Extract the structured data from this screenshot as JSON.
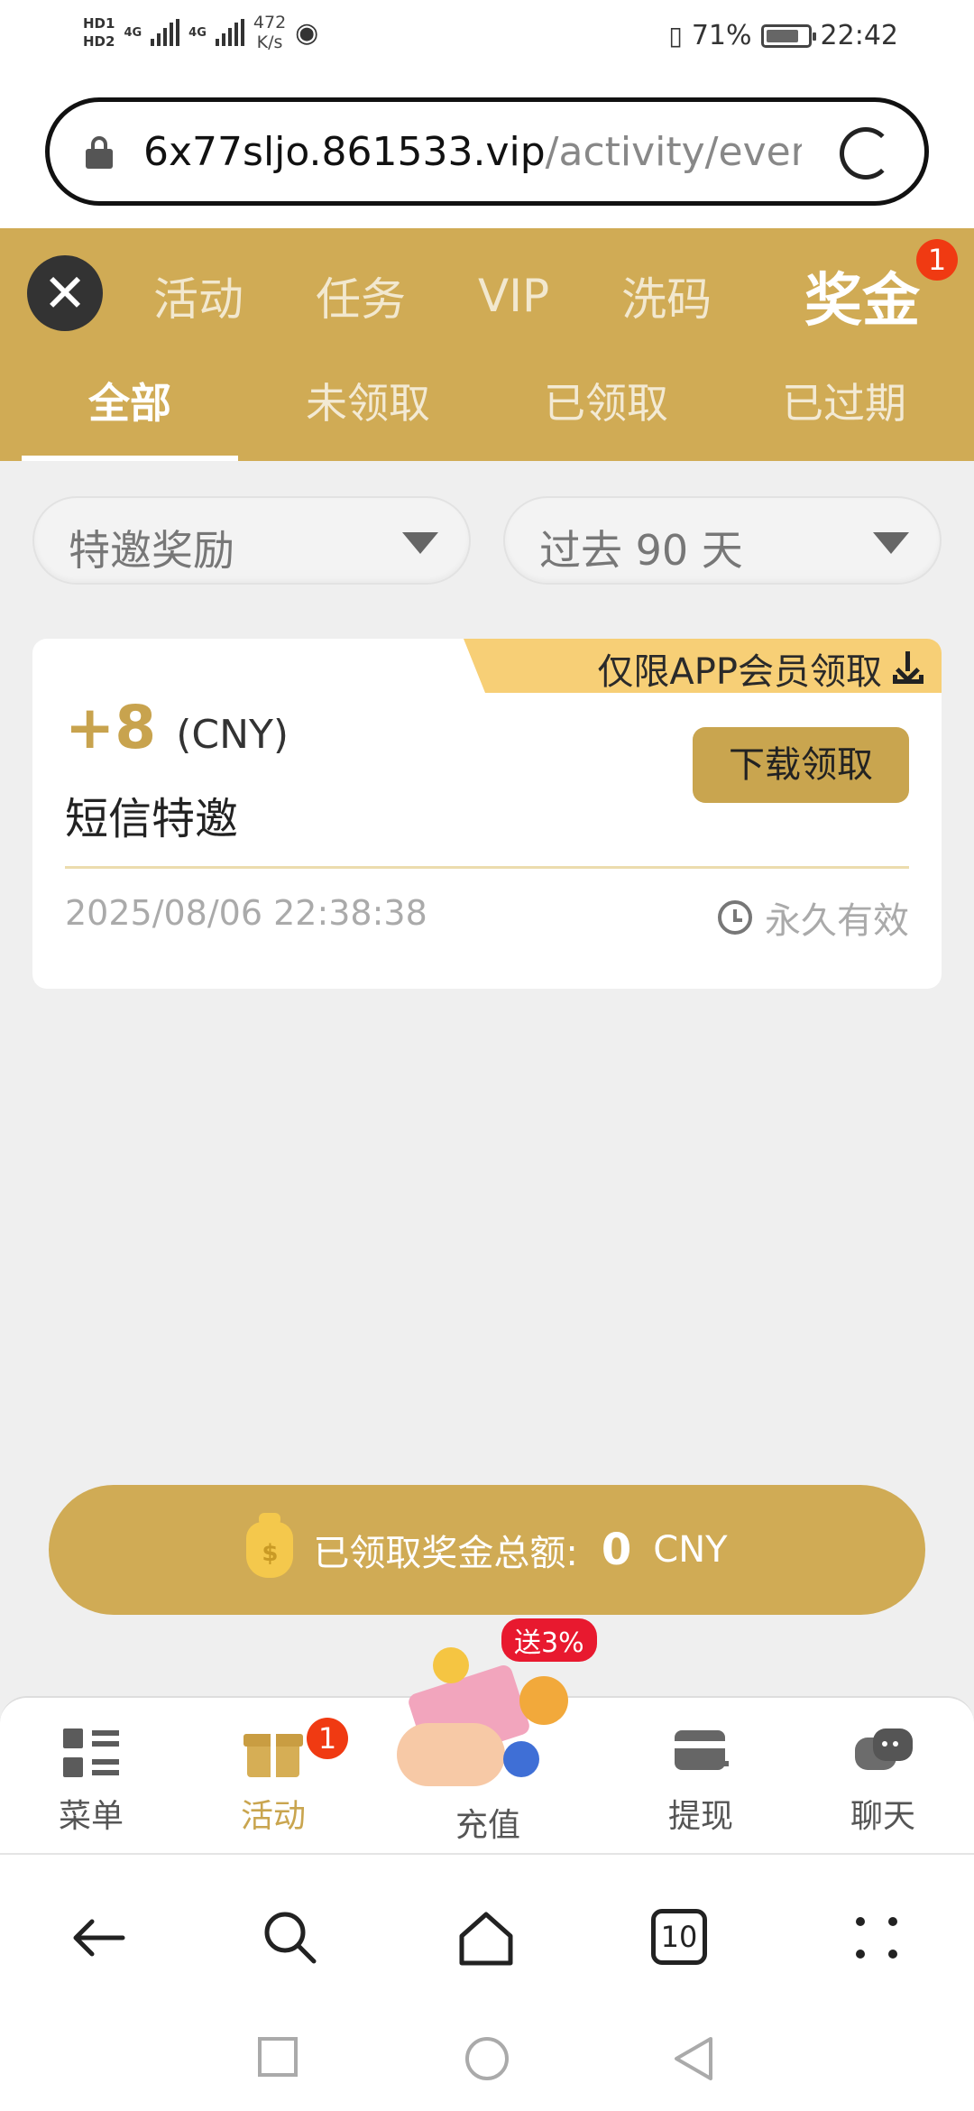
{
  "status_bar": {
    "hd1": "HD1",
    "hd2": "HD2",
    "signal1": "4G",
    "signal2": "4G",
    "speed_value": "472",
    "speed_unit": "K/s",
    "battery_pct": "71%",
    "time": "22:42"
  },
  "browser": {
    "url_host": "6x77sljo.861533.vip",
    "url_path": "/activity/event"
  },
  "top_nav": {
    "items": [
      "活动",
      "任务",
      "VIP",
      "洗码"
    ],
    "active": "奖金",
    "active_badge": "1"
  },
  "sub_tabs": [
    "全部",
    "未领取",
    "已领取",
    "已过期"
  ],
  "filters": {
    "type": "特邀奖励",
    "period": "过去 90 天"
  },
  "reward_card": {
    "tag": "仅限APP会员领取",
    "amount": "+8",
    "currency": "(CNY)",
    "description": "短信特邀",
    "button": "下载领取",
    "date": "2025/08/06 22:38:38",
    "validity": "永久有效"
  },
  "total": {
    "label": "已领取奖金总额:",
    "value": "0",
    "unit": "CNY"
  },
  "bottom_nav": {
    "menu": "菜单",
    "activity": "活动",
    "activity_badge": "1",
    "recharge": "充值",
    "recharge_promo": "送3%",
    "withdraw": "提现",
    "chat": "聊天"
  },
  "tabs_count": "10",
  "colors": {
    "gold": "#d0ab55",
    "badge": "#f03a12",
    "tag_yellow": "#f7cf76"
  }
}
